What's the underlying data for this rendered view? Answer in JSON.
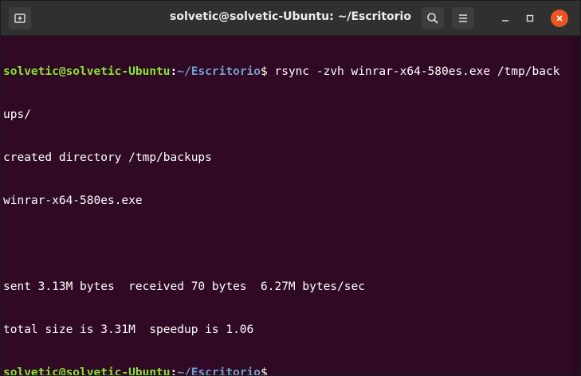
{
  "window": {
    "title": "solvetic@solvetic-Ubuntu: ~/Escritorio"
  },
  "icons": {
    "new_tab": "new-tab-icon",
    "search": "search-icon",
    "menu": "hamburger-menu-icon",
    "minimize": "minimize-icon",
    "maximize": "maximize-icon",
    "close": "close-icon"
  },
  "colors": {
    "terminal_bg": "#300a24",
    "prompt_user": "#8ae234",
    "prompt_path": "#729fcf",
    "close_button": "#e95420"
  },
  "terminal": {
    "prompt_user": "solvetic@solvetic-Ubuntu",
    "prompt_sep": ":",
    "prompt_path": "~/Escritorio",
    "prompt_symbol": "$",
    "command": " rsync -zvh winrar-x64-580es.exe /tmp/back",
    "command_wrap": "ups/",
    "output": [
      "created directory /tmp/backups",
      "winrar-x64-580es.exe",
      "",
      "sent 3.13M bytes  received 70 bytes  6.27M bytes/sec",
      "total size is 3.31M  speedup is 1.06"
    ]
  }
}
